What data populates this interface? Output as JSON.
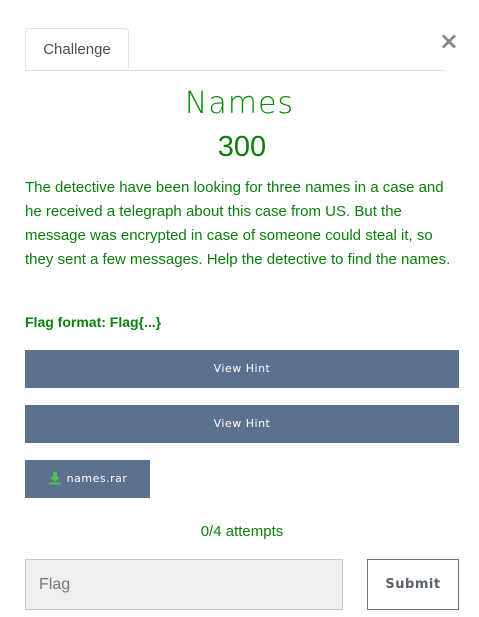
{
  "modal": {
    "tab_label": "Challenge",
    "close_glyph": "×"
  },
  "challenge": {
    "name": "Names",
    "points": "300",
    "description": "The detective have been looking for three names in a case and he received a telegraph about this case from US. But the message was encrypted in case of someone could steal it, so they sent a few messages. Help the detective to find the names.",
    "flag_format": "Flag format: Flag{...}"
  },
  "hints": [
    {
      "label": "View Hint"
    },
    {
      "label": "View Hint"
    }
  ],
  "files": [
    {
      "name": "names.rar",
      "icon": "download-icon"
    }
  ],
  "attempts": "0/4 attempts",
  "submission": {
    "placeholder": "Flag",
    "submit_label": "Submit"
  },
  "colors": {
    "accent_green": "#0a7f0a",
    "button_slate": "#5b718e"
  }
}
